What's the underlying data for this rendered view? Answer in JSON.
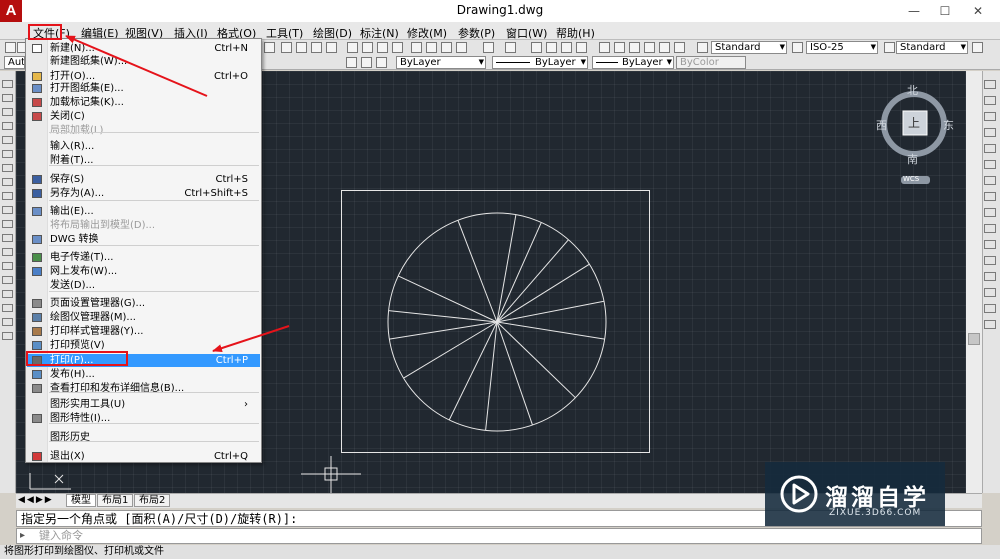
{
  "window": {
    "title": "Drawing1.dwg",
    "app_logo": "A",
    "controls": [
      "—",
      "☐",
      "✕"
    ]
  },
  "menubar": [
    "文件(F)",
    "编辑(E)",
    "视图(V)",
    "插入(I)",
    "格式(O)",
    "工具(T)",
    "绘图(D)",
    "标注(N)",
    "修改(M)",
    "参数(P)",
    "窗口(W)",
    "帮助(H)"
  ],
  "toolbar": {
    "style_text": "Standard",
    "style_dim": "ISO-25",
    "style_table": "Standard",
    "workspace_prefix": "Aut",
    "layer_color": "ByLayer",
    "layer_linetype": "ByLayer",
    "layer_lineweight": "ByLayer",
    "plot_style": "ByColor"
  },
  "file_menu": {
    "items": [
      {
        "label": "新建(N)...",
        "shortcut": "Ctrl+N",
        "icon": "new-file-icon",
        "disabled": false
      },
      {
        "label": "新建图纸集(W)...",
        "shortcut": "",
        "icon": "",
        "disabled": false
      },
      {
        "label": "打开(O)...",
        "shortcut": "Ctrl+O",
        "icon": "open-folder-icon",
        "disabled": false
      },
      {
        "label": "打开图纸集(E)...",
        "shortcut": "",
        "icon": "open-sheet-set-icon",
        "disabled": false
      },
      {
        "label": "加载标记集(K)...",
        "shortcut": "",
        "icon": "markup-set-icon",
        "disabled": false
      },
      {
        "label": "关闭(C)",
        "shortcut": "",
        "icon": "close-icon",
        "disabled": false
      },
      {
        "label": "局部加载(L)",
        "shortcut": "",
        "icon": "",
        "disabled": true
      },
      {
        "label": "输入(R)...",
        "shortcut": "",
        "icon": "",
        "disabled": false
      },
      {
        "label": "附着(T)...",
        "shortcut": "",
        "icon": "",
        "disabled": false
      },
      {
        "label": "保存(S)",
        "shortcut": "Ctrl+S",
        "icon": "save-icon",
        "disabled": false
      },
      {
        "label": "另存为(A)...",
        "shortcut": "Ctrl+Shift+S",
        "icon": "save-as-icon",
        "disabled": false
      },
      {
        "label": "输出(E)...",
        "shortcut": "",
        "icon": "export-icon",
        "disabled": false
      },
      {
        "label": "将布局输出到模型(D)...",
        "shortcut": "",
        "icon": "",
        "disabled": true
      },
      {
        "label": "DWG 转换",
        "shortcut": "",
        "icon": "dwg-convert-icon",
        "disabled": false
      },
      {
        "label": "电子传递(T)...",
        "shortcut": "",
        "icon": "etransmit-icon",
        "disabled": false
      },
      {
        "label": "网上发布(W)...",
        "shortcut": "",
        "icon": "publish-web-icon",
        "disabled": false
      },
      {
        "label": "发送(D)...",
        "shortcut": "",
        "icon": "",
        "disabled": false
      },
      {
        "label": "页面设置管理器(G)...",
        "shortcut": "",
        "icon": "page-setup-icon",
        "disabled": false
      },
      {
        "label": "绘图仪管理器(M)...",
        "shortcut": "",
        "icon": "plotter-manager-icon",
        "disabled": false
      },
      {
        "label": "打印样式管理器(Y)...",
        "shortcut": "",
        "icon": "plot-style-icon",
        "disabled": false
      },
      {
        "label": "打印预览(V)",
        "shortcut": "",
        "icon": "plot-preview-icon",
        "disabled": false
      },
      {
        "label": "打印(P)...",
        "shortcut": "Ctrl+P",
        "icon": "print-icon",
        "disabled": false,
        "highlighted": true
      },
      {
        "label": "发布(H)...",
        "shortcut": "",
        "icon": "publish-icon",
        "disabled": false
      },
      {
        "label": "查看打印和发布详细信息(B)...",
        "shortcut": "",
        "icon": "plot-details-icon",
        "disabled": false
      },
      {
        "label": "图形实用工具(U)",
        "shortcut": "›",
        "icon": "",
        "disabled": false
      },
      {
        "label": "图形特性(I)...",
        "shortcut": "",
        "icon": "drawing-properties-icon",
        "disabled": false
      },
      {
        "label": "图形历史",
        "shortcut": "",
        "icon": "",
        "disabled": false
      },
      {
        "label": "退出(X)",
        "shortcut": "Ctrl+Q",
        "icon": "exit-icon",
        "disabled": false
      }
    ]
  },
  "viewcube": {
    "north": "北",
    "south": "南",
    "east": "东",
    "west": "西",
    "face": "上",
    "wcs": "WCS"
  },
  "tabs": [
    "模型",
    "布局1",
    "布局2"
  ],
  "command": {
    "history": "指定另一个角点或 [面积(A)/尺寸(D)/旋转(R)]:",
    "placeholder": "键入命令"
  },
  "status_text": "将图形打印到绘图仪、打印机或文件",
  "watermark": {
    "brand": "溜溜自学",
    "url": "ZIXUE.3D66.COM"
  },
  "colors": {
    "canvas_bg": "#212830",
    "highlight": "#3399ff",
    "annotation_red": "#e5131a",
    "app_red": "#b50e0e"
  }
}
